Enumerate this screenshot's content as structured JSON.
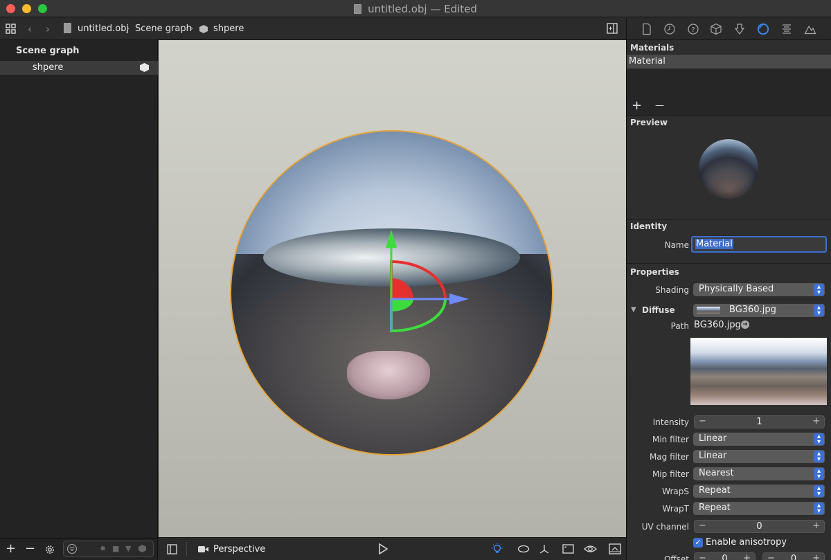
{
  "window": {
    "title": "untitled.obj — Edited"
  },
  "pathbar": {
    "crumbs": [
      "untitled.obj",
      "Scene graph",
      "shpere"
    ]
  },
  "scene_graph": {
    "title": "Scene graph",
    "items": [
      {
        "label": "shpere"
      }
    ]
  },
  "viewport": {
    "camera": "Perspective"
  },
  "inspector": {
    "materials": {
      "title": "Materials",
      "items": [
        "Material"
      ],
      "add": "+",
      "remove": "—"
    },
    "preview": {
      "title": "Preview"
    },
    "identity": {
      "title": "Identity",
      "name_label": "Name",
      "name_value": "Material"
    },
    "properties": {
      "title": "Properties",
      "shading_label": "Shading",
      "shading_value": "Physically Based",
      "diffuse_label": "Diffuse",
      "diffuse_value": "BG360.jpg",
      "path_label": "Path",
      "path_value": "BG360.jpg",
      "intensity_label": "Intensity",
      "intensity_value": "1",
      "min_filter_label": "Min filter",
      "min_filter_value": "Linear",
      "mag_filter_label": "Mag filter",
      "mag_filter_value": "Linear",
      "mip_filter_label": "Mip filter",
      "mip_filter_value": "Nearest",
      "wraps_label": "WrapS",
      "wraps_value": "Repeat",
      "wrapt_label": "WrapT",
      "wrapt_value": "Repeat",
      "uv_label": "UV channel",
      "uv_value": "0",
      "anisotropy_label": "Enable anisotropy",
      "offset_label": "Offset",
      "offset_x": "0",
      "offset_y": "0"
    }
  },
  "colors": {
    "accent": "#3b70d6",
    "selection_outline": "#e6a437",
    "axis_x": "#6f8cff",
    "axis_y": "#3ddc3d",
    "axis_z": "#e53030"
  }
}
